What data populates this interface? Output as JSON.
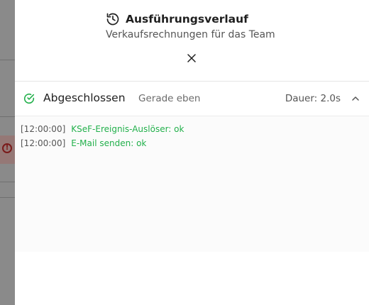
{
  "panel": {
    "title": "Ausführungsverlauf",
    "subtitle": "Verkaufsrechnungen für das Team",
    "title_icon": "history-icon",
    "close_icon": "close-icon"
  },
  "run": {
    "status": "Abgeschlossen",
    "when": "Gerade eben",
    "duration": "Dauer: 2.0s",
    "status_icon": "check-circle-icon",
    "expanded": true,
    "colors": {
      "success": "#22b04b"
    }
  },
  "logs": [
    {
      "time": "[12:00:00]",
      "message": "KSeF-Ereignis-Auslöser: ok"
    },
    {
      "time": "[12:00:00]",
      "message": "E-Mail senden: ok"
    }
  ]
}
